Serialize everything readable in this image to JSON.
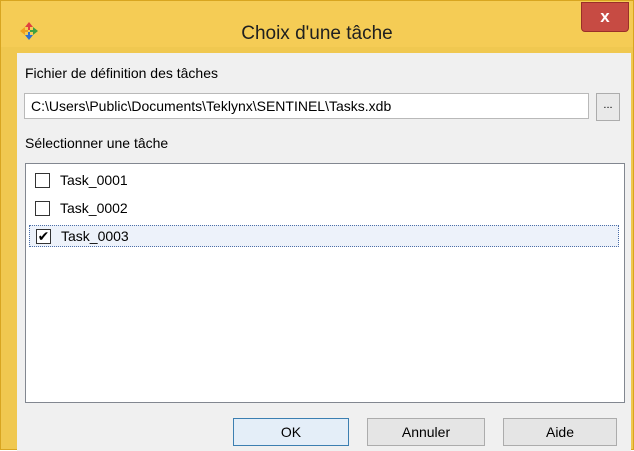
{
  "window": {
    "title": "Choix d'une tâche",
    "close_glyph": "x",
    "app_icon": "colored-arrows-icon"
  },
  "file_section": {
    "label": "Fichier de définition des tâches",
    "path_value": "C:\\Users\\Public\\Documents\\Teklynx\\SENTINEL\\Tasks.xdb",
    "browse_label": "..."
  },
  "task_section": {
    "label": "Sélectionner une tâche",
    "tasks": [
      {
        "label": "Task_0001",
        "checked": false,
        "check_glyph": ""
      },
      {
        "label": "Task_0002",
        "checked": false,
        "check_glyph": ""
      },
      {
        "label": "Task_0003",
        "checked": true,
        "check_glyph": "✔"
      }
    ]
  },
  "buttons": {
    "ok": "OK",
    "cancel": "Annuler",
    "help": "Aide"
  },
  "colors": {
    "titlebar": "#f5cc55",
    "close": "#c74b43",
    "selection_border": "#4d6fa8"
  }
}
